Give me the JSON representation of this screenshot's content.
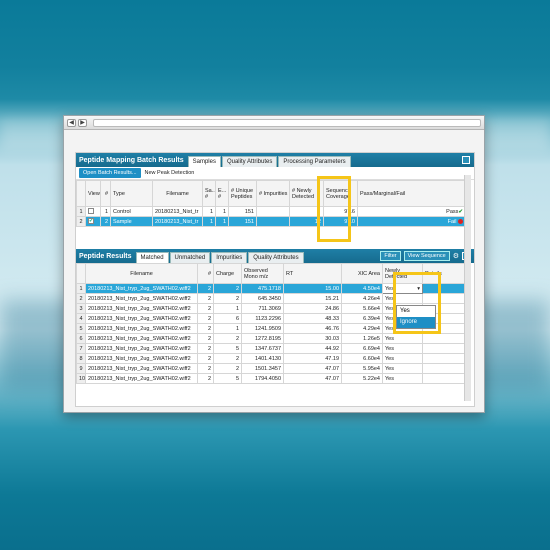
{
  "browser": {
    "back": "◀",
    "forward": "▶"
  },
  "batch_panel": {
    "title": "Peptide Mapping Batch Results",
    "tabs": [
      "Samples",
      "Quality Attributes",
      "Processing Parameters"
    ],
    "open_button": "Open Batch Results...",
    "new_peak_label": "New Peak Detection",
    "columns": [
      "View",
      "#",
      "Type",
      "Filename",
      "Sa... #",
      "E... #",
      "# Unique Peptides",
      "# Impurities",
      "# Newly Detected",
      "Sequence Coverage",
      "Pass/Marginal/Fail"
    ],
    "rows": [
      {
        "row": "1",
        "num": "1",
        "type": "Control",
        "filename": "20180213_Nist_tr",
        "sa": "1",
        "e": "1",
        "unique": "151",
        "impurities": "",
        "newly": "",
        "coverage": "97.6",
        "status": "Pass",
        "status_icon": "check-icon"
      },
      {
        "row": "2",
        "num": "2",
        "type": "Sample",
        "filename": "20180213_Nist_tr",
        "sa": "1",
        "e": "1",
        "unique": "151",
        "impurities": "",
        "newly": "12",
        "coverage": "97.0",
        "status": "Fail",
        "status_icon": "fail-dot-icon"
      }
    ]
  },
  "results_panel": {
    "title": "Peptide Results",
    "tabs": [
      "Matched",
      "Unmatched",
      "Impurities",
      "Quality Attributes"
    ],
    "filter_button": "Filter",
    "view_sequence_button": "View Sequence",
    "columns": [
      "Filename",
      "#",
      "Charge",
      "Observed Mono m/z",
      "RT",
      "XIC Area",
      "Newly Detected",
      "Details"
    ],
    "rows": [
      {
        "row": "1",
        "filename": "20180213_Nist_tryp_2ug_SWATH02.wiff2",
        "num": "2",
        "charge": "2",
        "mz": "475.1718",
        "rt": "15.00",
        "xic": "4.50e4",
        "newly": "Yes"
      },
      {
        "row": "2",
        "filename": "20180213_Nist_tryp_2ug_SWATH02.wiff2",
        "num": "2",
        "charge": "2",
        "mz": "645.3450",
        "rt": "15.21",
        "xic": "4.26e4",
        "newly": "Yes"
      },
      {
        "row": "3",
        "filename": "20180213_Nist_tryp_2ug_SWATH02.wiff2",
        "num": "2",
        "charge": "1",
        "mz": "711.3069",
        "rt": "24.86",
        "xic": "5.66e4",
        "newly": "Yes"
      },
      {
        "row": "4",
        "filename": "20180213_Nist_tryp_2ug_SWATH02.wiff2",
        "num": "2",
        "charge": "6",
        "mz": "1123.2296",
        "rt": "48.33",
        "xic": "6.39e4",
        "newly": "Yes"
      },
      {
        "row": "5",
        "filename": "20180213_Nist_tryp_2ug_SWATH02.wiff2",
        "num": "2",
        "charge": "1",
        "mz": "1241.9509",
        "rt": "46.76",
        "xic": "4.29e4",
        "newly": "Yes"
      },
      {
        "row": "6",
        "filename": "20180213_Nist_tryp_2ug_SWATH02.wiff2",
        "num": "2",
        "charge": "2",
        "mz": "1272.8195",
        "rt": "30.03",
        "xic": "1.26e5",
        "newly": "Yes"
      },
      {
        "row": "7",
        "filename": "20180213_Nist_tryp_2ug_SWATH02.wiff2",
        "num": "2",
        "charge": "5",
        "mz": "1347.6737",
        "rt": "44.92",
        "xic": "6.69e4",
        "newly": "Yes"
      },
      {
        "row": "8",
        "filename": "20180213_Nist_tryp_2ug_SWATH02.wiff2",
        "num": "2",
        "charge": "2",
        "mz": "1401.4130",
        "rt": "47.19",
        "xic": "6.60e4",
        "newly": "Yes"
      },
      {
        "row": "9",
        "filename": "20180213_Nist_tryp_2ug_SWATH02.wiff2",
        "num": "2",
        "charge": "2",
        "mz": "1501.3457",
        "rt": "47.07",
        "xic": "5.95e4",
        "newly": "Yes"
      },
      {
        "row": "10",
        "filename": "20180213_Nist_tryp_2ug_SWATH02.wiff2",
        "num": "2",
        "charge": "5",
        "mz": "1794.4050",
        "rt": "47.07",
        "xic": "5.22e4",
        "newly": "Yes"
      }
    ],
    "dropdown_options": [
      "Yes",
      "Ignore"
    ]
  },
  "colors": {
    "header": "#166b8e",
    "selection": "#2aa6d8",
    "highlight": "#f5c518",
    "button": "#1e8fc5"
  }
}
